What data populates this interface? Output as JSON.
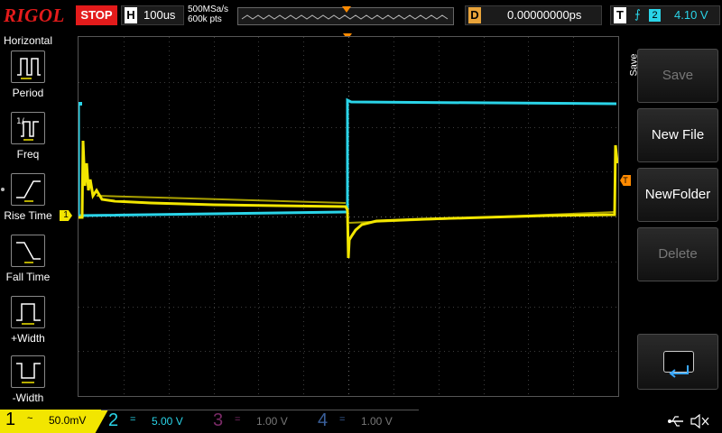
{
  "header": {
    "brand": "RIGOL",
    "run_state": "STOP",
    "timebase_key": "H",
    "timebase": "100us",
    "sample_rate": "500MSa/s",
    "memory_depth": "600k pts",
    "delay_key": "D",
    "delay": "0.00000000ps",
    "trigger_key": "T",
    "trigger_source": "2",
    "trigger_level": "4.10 V"
  },
  "left_menu": {
    "title": "Horizontal",
    "items": [
      {
        "label": "Period",
        "icon": "period-icon"
      },
      {
        "label": "Freq",
        "icon": "frequency-icon"
      },
      {
        "label": "Rise Time",
        "icon": "rise-time-icon"
      },
      {
        "label": "Fall Time",
        "icon": "fall-time-icon"
      },
      {
        "label": "+Width",
        "icon": "positive-width-icon"
      },
      {
        "label": "-Width",
        "icon": "negative-width-icon"
      }
    ]
  },
  "right_menu": {
    "title": "Save",
    "buttons": [
      {
        "label": "Save",
        "enabled": false
      },
      {
        "label": "New File",
        "enabled": true
      },
      {
        "label": "NewFolder",
        "enabled": true
      },
      {
        "label": "Delete",
        "enabled": false
      }
    ],
    "back_icon": "return-arrow-icon"
  },
  "markers": {
    "ch1": "1",
    "trigger": "T"
  },
  "channels": [
    {
      "num": "1",
      "coupling": "~",
      "scale": "50.0mV",
      "color": "#f2e600",
      "active": true
    },
    {
      "num": "2",
      "coupling": "=",
      "scale": "5.00 V",
      "color": "#2ad4e8",
      "active": true
    },
    {
      "num": "3",
      "coupling": "=",
      "scale": "1.00 V",
      "color": "#c0208c",
      "active": false
    },
    {
      "num": "4",
      "coupling": "=",
      "scale": "1.00 V",
      "color": "#3a7ee0",
      "active": false
    }
  ],
  "colors": {
    "ch1": "#f2e600",
    "ch2": "#2ad4e8",
    "trigger": "#ff8a00",
    "stop": "#e31b1b"
  },
  "status_icons": [
    "usb-icon",
    "mute-icon"
  ]
}
